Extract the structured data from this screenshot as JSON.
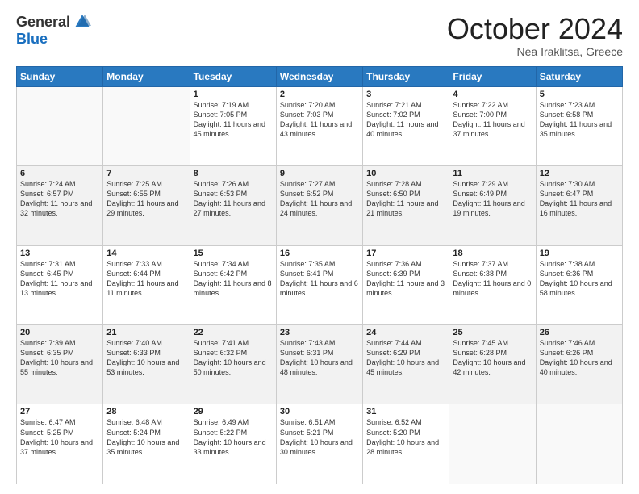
{
  "header": {
    "logo_general": "General",
    "logo_blue": "Blue",
    "month_title": "October 2024",
    "location": "Nea Iraklitsa, Greece"
  },
  "days_of_week": [
    "Sunday",
    "Monday",
    "Tuesday",
    "Wednesday",
    "Thursday",
    "Friday",
    "Saturday"
  ],
  "weeks": [
    [
      {
        "day": "",
        "sunrise": "",
        "sunset": "",
        "daylight": ""
      },
      {
        "day": "",
        "sunrise": "",
        "sunset": "",
        "daylight": ""
      },
      {
        "day": "1",
        "sunrise": "Sunrise: 7:19 AM",
        "sunset": "Sunset: 7:05 PM",
        "daylight": "Daylight: 11 hours and 45 minutes."
      },
      {
        "day": "2",
        "sunrise": "Sunrise: 7:20 AM",
        "sunset": "Sunset: 7:03 PM",
        "daylight": "Daylight: 11 hours and 43 minutes."
      },
      {
        "day": "3",
        "sunrise": "Sunrise: 7:21 AM",
        "sunset": "Sunset: 7:02 PM",
        "daylight": "Daylight: 11 hours and 40 minutes."
      },
      {
        "day": "4",
        "sunrise": "Sunrise: 7:22 AM",
        "sunset": "Sunset: 7:00 PM",
        "daylight": "Daylight: 11 hours and 37 minutes."
      },
      {
        "day": "5",
        "sunrise": "Sunrise: 7:23 AM",
        "sunset": "Sunset: 6:58 PM",
        "daylight": "Daylight: 11 hours and 35 minutes."
      }
    ],
    [
      {
        "day": "6",
        "sunrise": "Sunrise: 7:24 AM",
        "sunset": "Sunset: 6:57 PM",
        "daylight": "Daylight: 11 hours and 32 minutes."
      },
      {
        "day": "7",
        "sunrise": "Sunrise: 7:25 AM",
        "sunset": "Sunset: 6:55 PM",
        "daylight": "Daylight: 11 hours and 29 minutes."
      },
      {
        "day": "8",
        "sunrise": "Sunrise: 7:26 AM",
        "sunset": "Sunset: 6:53 PM",
        "daylight": "Daylight: 11 hours and 27 minutes."
      },
      {
        "day": "9",
        "sunrise": "Sunrise: 7:27 AM",
        "sunset": "Sunset: 6:52 PM",
        "daylight": "Daylight: 11 hours and 24 minutes."
      },
      {
        "day": "10",
        "sunrise": "Sunrise: 7:28 AM",
        "sunset": "Sunset: 6:50 PM",
        "daylight": "Daylight: 11 hours and 21 minutes."
      },
      {
        "day": "11",
        "sunrise": "Sunrise: 7:29 AM",
        "sunset": "Sunset: 6:49 PM",
        "daylight": "Daylight: 11 hours and 19 minutes."
      },
      {
        "day": "12",
        "sunrise": "Sunrise: 7:30 AM",
        "sunset": "Sunset: 6:47 PM",
        "daylight": "Daylight: 11 hours and 16 minutes."
      }
    ],
    [
      {
        "day": "13",
        "sunrise": "Sunrise: 7:31 AM",
        "sunset": "Sunset: 6:45 PM",
        "daylight": "Daylight: 11 hours and 13 minutes."
      },
      {
        "day": "14",
        "sunrise": "Sunrise: 7:33 AM",
        "sunset": "Sunset: 6:44 PM",
        "daylight": "Daylight: 11 hours and 11 minutes."
      },
      {
        "day": "15",
        "sunrise": "Sunrise: 7:34 AM",
        "sunset": "Sunset: 6:42 PM",
        "daylight": "Daylight: 11 hours and 8 minutes."
      },
      {
        "day": "16",
        "sunrise": "Sunrise: 7:35 AM",
        "sunset": "Sunset: 6:41 PM",
        "daylight": "Daylight: 11 hours and 6 minutes."
      },
      {
        "day": "17",
        "sunrise": "Sunrise: 7:36 AM",
        "sunset": "Sunset: 6:39 PM",
        "daylight": "Daylight: 11 hours and 3 minutes."
      },
      {
        "day": "18",
        "sunrise": "Sunrise: 7:37 AM",
        "sunset": "Sunset: 6:38 PM",
        "daylight": "Daylight: 11 hours and 0 minutes."
      },
      {
        "day": "19",
        "sunrise": "Sunrise: 7:38 AM",
        "sunset": "Sunset: 6:36 PM",
        "daylight": "Daylight: 10 hours and 58 minutes."
      }
    ],
    [
      {
        "day": "20",
        "sunrise": "Sunrise: 7:39 AM",
        "sunset": "Sunset: 6:35 PM",
        "daylight": "Daylight: 10 hours and 55 minutes."
      },
      {
        "day": "21",
        "sunrise": "Sunrise: 7:40 AM",
        "sunset": "Sunset: 6:33 PM",
        "daylight": "Daylight: 10 hours and 53 minutes."
      },
      {
        "day": "22",
        "sunrise": "Sunrise: 7:41 AM",
        "sunset": "Sunset: 6:32 PM",
        "daylight": "Daylight: 10 hours and 50 minutes."
      },
      {
        "day": "23",
        "sunrise": "Sunrise: 7:43 AM",
        "sunset": "Sunset: 6:31 PM",
        "daylight": "Daylight: 10 hours and 48 minutes."
      },
      {
        "day": "24",
        "sunrise": "Sunrise: 7:44 AM",
        "sunset": "Sunset: 6:29 PM",
        "daylight": "Daylight: 10 hours and 45 minutes."
      },
      {
        "day": "25",
        "sunrise": "Sunrise: 7:45 AM",
        "sunset": "Sunset: 6:28 PM",
        "daylight": "Daylight: 10 hours and 42 minutes."
      },
      {
        "day": "26",
        "sunrise": "Sunrise: 7:46 AM",
        "sunset": "Sunset: 6:26 PM",
        "daylight": "Daylight: 10 hours and 40 minutes."
      }
    ],
    [
      {
        "day": "27",
        "sunrise": "Sunrise: 6:47 AM",
        "sunset": "Sunset: 5:25 PM",
        "daylight": "Daylight: 10 hours and 37 minutes."
      },
      {
        "day": "28",
        "sunrise": "Sunrise: 6:48 AM",
        "sunset": "Sunset: 5:24 PM",
        "daylight": "Daylight: 10 hours and 35 minutes."
      },
      {
        "day": "29",
        "sunrise": "Sunrise: 6:49 AM",
        "sunset": "Sunset: 5:22 PM",
        "daylight": "Daylight: 10 hours and 33 minutes."
      },
      {
        "day": "30",
        "sunrise": "Sunrise: 6:51 AM",
        "sunset": "Sunset: 5:21 PM",
        "daylight": "Daylight: 10 hours and 30 minutes."
      },
      {
        "day": "31",
        "sunrise": "Sunrise: 6:52 AM",
        "sunset": "Sunset: 5:20 PM",
        "daylight": "Daylight: 10 hours and 28 minutes."
      },
      {
        "day": "",
        "sunrise": "",
        "sunset": "",
        "daylight": ""
      },
      {
        "day": "",
        "sunrise": "",
        "sunset": "",
        "daylight": ""
      }
    ]
  ]
}
